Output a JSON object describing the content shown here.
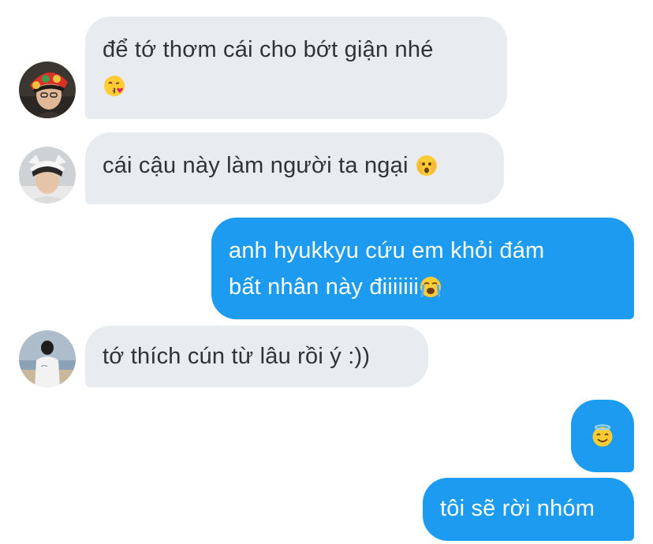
{
  "conversation": {
    "messages": [
      {
        "sender": "incoming",
        "text_line1": "để tớ thơm cái cho bớt giận nhé",
        "emoji": "kissing-heart-emoji",
        "avatar": "avatar-red-beanie"
      },
      {
        "sender": "incoming",
        "text": "cái cậu này làm người ta ngại",
        "emoji": "peeking-face-emoji",
        "avatar": "avatar-white-hat"
      },
      {
        "sender": "outgoing",
        "text_line1": "anh hyukkyu cứu em khỏi đám",
        "text_line2": "bất nhân này điiiiiii",
        "emoji": "loudly-crying-emoji"
      },
      {
        "sender": "incoming",
        "text": "tớ thích cún từ lâu rồi ý :))",
        "avatar": "avatar-beach-back"
      },
      {
        "sender": "outgoing",
        "emoji": "smiling-halo-emoji"
      },
      {
        "sender": "outgoing",
        "text": "tôi sẽ rời nhóm"
      }
    ]
  },
  "colors": {
    "incoming_bubble": "#e8ebef",
    "outgoing_bubble": "#1d9bf0",
    "incoming_text": "#2f3236",
    "outgoing_text": "#ffffff"
  }
}
